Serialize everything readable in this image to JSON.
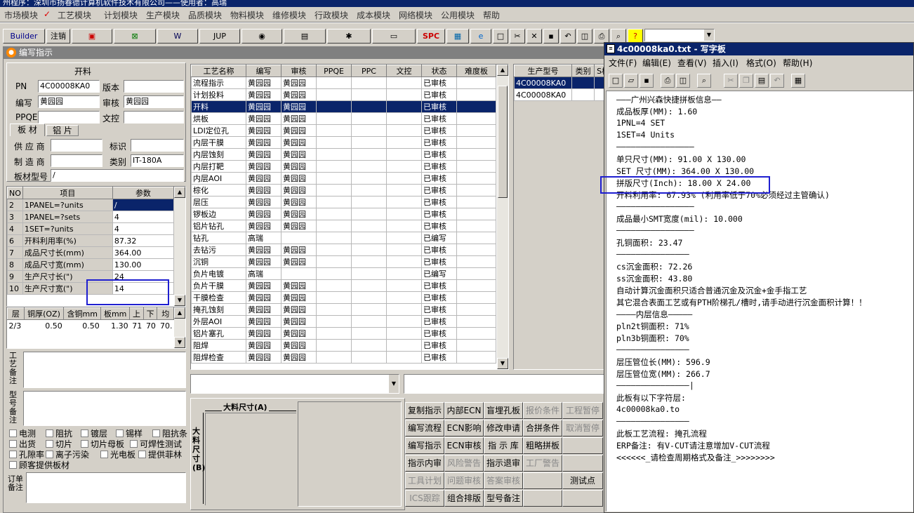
{
  "app": {
    "title": "州程序：深圳市扬春德计算机软件技术有限公司——使用者：高瑞"
  },
  "menu": [
    "市场模块",
    "工艺模块",
    "计划模块",
    "生产模块",
    "品质模块",
    "物料模块",
    "维修模块",
    "行政模块",
    "成本模块",
    "网络模块",
    "公用模块",
    "帮助"
  ],
  "menu_checked": "✓",
  "toolbar": {
    "builder": "Builder",
    "logout": "注销",
    "jup": "JUP",
    "spc": "SPC"
  },
  "window": {
    "title": "编写指示"
  },
  "header": {
    "section": "开料",
    "pn_label": "PN",
    "pn": "4C00008KA0",
    "version_label": "版本",
    "version": "",
    "author_label": "编写",
    "author": "黄园园",
    "review_label": "审核",
    "reviewer": "黄园园",
    "ppqe_label": "PPQE",
    "ppqe": "",
    "control_label": "文控",
    "control": ""
  },
  "material_tabs": [
    "板 材",
    "铝 片"
  ],
  "material": {
    "supplier_label": "供 应 商",
    "supplier": "",
    "mark_label": "标识",
    "mark": "",
    "maker_label": "制 造 商",
    "maker": "",
    "type_label": "类别",
    "type": "IT-180A",
    "model_label": "板材型号",
    "model": "/"
  },
  "params": {
    "headers": [
      "NO",
      "项目",
      "参数"
    ],
    "rows": [
      [
        "2",
        "1PANEL=?units",
        "/"
      ],
      [
        "3",
        "1PANEL=?sets",
        "4"
      ],
      [
        "4",
        "1SET=?units",
        "4"
      ],
      [
        "6",
        "开料利用率(%)",
        "87.32"
      ],
      [
        "7",
        "成品尺寸长(mm)",
        "364.00"
      ],
      [
        "8",
        "成品尺寸宽(mm)",
        "130.00"
      ],
      [
        "9",
        "生产尺寸长(\")",
        "24"
      ],
      [
        "10",
        "生产尺寸宽(\")",
        "14"
      ]
    ]
  },
  "layers": {
    "headers": [
      "层",
      "铜厚(OZ)",
      "含铜mm",
      "板mm",
      "上",
      "下",
      "均"
    ],
    "rows": [
      [
        "2/3",
        "0.50",
        "0.50",
        "1.30",
        "71",
        "70",
        "70."
      ]
    ]
  },
  "notes": {
    "process_label": "工艺备注",
    "model_label": "型号备注",
    "order_label": "订单备注"
  },
  "checks": [
    [
      "电测",
      "阻抗",
      "镀层",
      "锡样",
      "阻抗条"
    ],
    [
      "出货",
      "切片",
      "切片母板",
      "可焊性测试"
    ],
    [
      "孔隙率",
      "离子污染",
      "光电板",
      "提供菲林"
    ],
    [
      "顾客提供板材"
    ]
  ],
  "process": {
    "headers": [
      "工艺名称",
      "编写",
      "审核",
      "PPQE",
      "PPC",
      "文控",
      "状态",
      "难度板"
    ],
    "rows": [
      [
        "流程指示",
        "黄园园",
        "黄园园",
        "",
        "",
        "",
        "已审核",
        ""
      ],
      [
        "计划投料",
        "黄园园",
        "黄园园",
        "",
        "",
        "",
        "已审核",
        ""
      ],
      [
        "开料",
        "黄园园",
        "黄园园",
        "",
        "",
        "",
        "已审核",
        ""
      ],
      [
        "烘板",
        "黄园园",
        "黄园园",
        "",
        "",
        "",
        "已审核",
        ""
      ],
      [
        "LDI定位孔",
        "黄园园",
        "黄园园",
        "",
        "",
        "",
        "已审核",
        ""
      ],
      [
        "内层干膜",
        "黄园园",
        "黄园园",
        "",
        "",
        "",
        "已审核",
        ""
      ],
      [
        "内层蚀刻",
        "黄园园",
        "黄园园",
        "",
        "",
        "",
        "已审核",
        ""
      ],
      [
        "内层打靶",
        "黄园园",
        "黄园园",
        "",
        "",
        "",
        "已审核",
        ""
      ],
      [
        "内层AOI",
        "黄园园",
        "黄园园",
        "",
        "",
        "",
        "已审核",
        ""
      ],
      [
        "棕化",
        "黄园园",
        "黄园园",
        "",
        "",
        "",
        "已审核",
        ""
      ],
      [
        "层压",
        "黄园园",
        "黄园园",
        "",
        "",
        "",
        "已审核",
        ""
      ],
      [
        "锣板边",
        "黄园园",
        "黄园园",
        "",
        "",
        "",
        "已审核",
        ""
      ],
      [
        "铝片钻孔",
        "黄园园",
        "黄园园",
        "",
        "",
        "",
        "已审核",
        ""
      ],
      [
        "钻孔",
        "高瑞",
        "",
        "",
        "",
        "",
        "已编写",
        ""
      ],
      [
        "去钻污",
        "黄园园",
        "黄园园",
        "",
        "",
        "",
        "已审核",
        ""
      ],
      [
        "沉铜",
        "黄园园",
        "黄园园",
        "",
        "",
        "",
        "已审核",
        ""
      ],
      [
        "负片电镀",
        "高瑞",
        "",
        "",
        "",
        "",
        "已编写",
        ""
      ],
      [
        "负片干膜",
        "黄园园",
        "黄园园",
        "",
        "",
        "",
        "已审核",
        ""
      ],
      [
        "干膜检查",
        "黄园园",
        "黄园园",
        "",
        "",
        "",
        "已审核",
        ""
      ],
      [
        "掩孔蚀刻",
        "黄园园",
        "黄园园",
        "",
        "",
        "",
        "已审核",
        ""
      ],
      [
        "外层AOI",
        "黄园园",
        "黄园园",
        "",
        "",
        "",
        "已审核",
        ""
      ],
      [
        "铝片塞孔",
        "黄园园",
        "黄园园",
        "",
        "",
        "",
        "已审核",
        ""
      ],
      [
        "阻焊",
        "黄园园",
        "黄园园",
        "",
        "",
        "",
        "已审核",
        ""
      ],
      [
        "阻焊检查",
        "黄园园",
        "黄园园",
        "",
        "",
        "",
        "已审核",
        ""
      ]
    ]
  },
  "models": {
    "headers": [
      "生产型号",
      "类别",
      "S板"
    ],
    "rows": [
      [
        "4C00008KA0",
        "",
        ""
      ],
      [
        "4C00008KA0",
        "",
        ""
      ]
    ]
  },
  "drawing": {
    "length_label": "大料尺寸(A)",
    "width_label": "大料尺寸(B)"
  },
  "buttons": [
    [
      "复制指示",
      "内部ECN",
      "盲埋孔板",
      "报价条件",
      "工程暂停"
    ],
    [
      "编写流程",
      "ECN影响",
      "修改申请",
      "合拼条件",
      "取消暂停"
    ],
    [
      "编写指示",
      "ECN审核",
      "指 示 库",
      "粗略拼板",
      ""
    ],
    [
      "指示内审",
      "风险警告",
      "指示退审",
      "工厂警告",
      ""
    ],
    [
      "工具计划",
      "问题审核",
      "答案审核",
      "",
      "测试点"
    ],
    [
      "ICS跟踪",
      "组合排版",
      "型号备注",
      "",
      ""
    ]
  ],
  "disabled_buttons": [
    "报价条件",
    "工程暂停",
    "取消暂停",
    "风险警告",
    "工厂警告",
    "工具计划",
    "问题审核",
    "答案审核",
    "ICS跟踪"
  ],
  "notepad": {
    "title": "4c00008ka0.txt - 写字板",
    "menu": [
      "文件(F)",
      "编辑(E)",
      "查看(V)",
      "插入(I)",
      "格式(O)",
      "帮助(H)"
    ],
    "lines": [
      "———广州兴森快捷拼板信息——",
      "成品板厚(MM): 1.60",
      "1PNL=4 SET",
      "1SET=4 Units",
      "————————————————",
      "单只尺寸(MM): 91.00 X 130.00",
      "SET 尺寸(MM): 364.00 X 130.00",
      "拼版尺寸(Inch): 18.00 X 24.00",
      "开料利用率: 67.93% (利用率低于70%必须经过主管确认)",
      "————————————————",
      "成品最小SMT宽度(mil): 10.000",
      "————————————————",
      "孔铜面积: 23.47",
      "———————————————",
      "cs沉金面积: 72.26",
      "ss沉金面积: 43.80",
      "自动计算沉金面积只适合普通沉金及沉金+金手指工艺",
      "其它混合表面工艺或有PTH阶梯孔/槽时,请手动进行沉金面积计算！！",
      "————内层信息—————",
      "pln2t铜面积: 71%",
      "pln3b铜面积: 70%",
      "———————————————",
      "层压管位长(MM): 596.9",
      "层压管位宽(MM): 266.7",
      "———————————————|",
      "此板有以下字符层:",
      "4c00008ka0.to",
      "———————————————",
      "此板工艺流程: 掩孔流程",
      "ERP备注:  有V-CUT请注意增加V-CUT流程",
      "<<<<<<_请检查周期格式及备注_>>>>>>>>"
    ]
  }
}
